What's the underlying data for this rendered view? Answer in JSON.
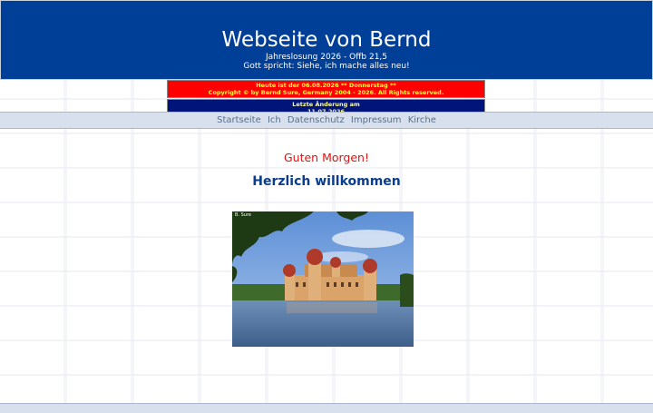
{
  "header": {
    "title": "Webseite von Bernd",
    "line1": "Jahreslosung 2026 -  Offb 21,5",
    "line2": "Gott spricht: Siehe, ich mache alles neu!"
  },
  "info": {
    "date_line": "Heute ist der 06.08.2026 ** Donnerstag **",
    "copyright_line": "Copyright © by Bernd Sure, Germany 2004 - 2026. All Rights reserved.",
    "changed_label": "Letzte Änderung am",
    "changed_date": "11.07.2026"
  },
  "nav": {
    "items": [
      "Startseite",
      "Ich",
      "Datenschutz",
      "Impressum",
      "Kirche"
    ]
  },
  "content": {
    "greeting": "Guten Morgen!",
    "welcome": "Herzlich willkommen",
    "photo_credit": "B. Sure"
  },
  "colors": {
    "header_bg": "#003f98",
    "nav_bg": "#d7e0ec",
    "greeting": "#e01010",
    "welcome": "#0a3d8f"
  }
}
